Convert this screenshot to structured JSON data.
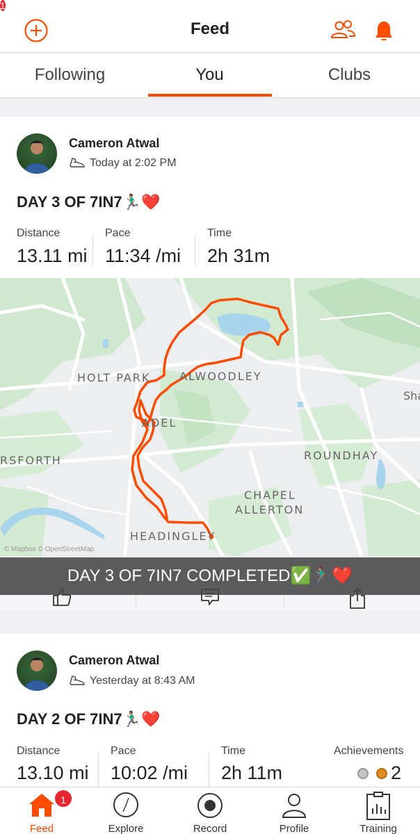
{
  "header": {
    "title": "Feed",
    "notification_count": "1"
  },
  "tabs": [
    {
      "label": "Following"
    },
    {
      "label": "You"
    },
    {
      "label": "Clubs"
    }
  ],
  "activities": [
    {
      "athlete": "Cameron Atwal",
      "time": "Today at 2:02 PM",
      "title": "DAY 3 OF 7IN7🏃🏽‍♂️❤️",
      "stats": [
        {
          "label": "Distance",
          "value": "13.11 mi"
        },
        {
          "label": "Pace",
          "value": "11:34 /mi"
        },
        {
          "label": "Time",
          "value": "2h 31m"
        }
      ],
      "map": {
        "labels": [
          "HOLT PARK",
          "ALWOODLEY",
          "ADEL",
          "RSFORTH",
          "ROUNDHAY",
          "CHAPEL",
          "ALLERTON",
          "HEADINGLEY",
          "Sha"
        ],
        "attribution": "© Mapbox © OpenStreetMap",
        "route_color": "#fc4c02"
      },
      "overlay_caption": "DAY 3 OF 7IN7 COMPLETED✅🏃🏽‍♂️❤️"
    },
    {
      "athlete": "Cameron Atwal",
      "time": "Yesterday at 8:43 AM",
      "title": "DAY 2 OF 7IN7🏃🏽‍♂️❤️",
      "stats": [
        {
          "label": "Distance",
          "value": "13.10 mi"
        },
        {
          "label": "Pace",
          "value": "10:02 /mi"
        },
        {
          "label": "Time",
          "value": "2h 11m"
        },
        {
          "label": "Achievements",
          "value": "2"
        }
      ]
    }
  ],
  "bottom_nav": {
    "items": [
      {
        "label": "Feed",
        "icon": "home-icon",
        "active": true
      },
      {
        "label": "Explore",
        "icon": "compass-icon"
      },
      {
        "label": "Record",
        "icon": "record-icon"
      },
      {
        "label": "Profile",
        "icon": "profile-icon"
      },
      {
        "label": "Training",
        "icon": "training-icon"
      }
    ],
    "feed_badge": "1"
  },
  "colors": {
    "accent": "#fc4c02",
    "badge": "#e8262f"
  }
}
